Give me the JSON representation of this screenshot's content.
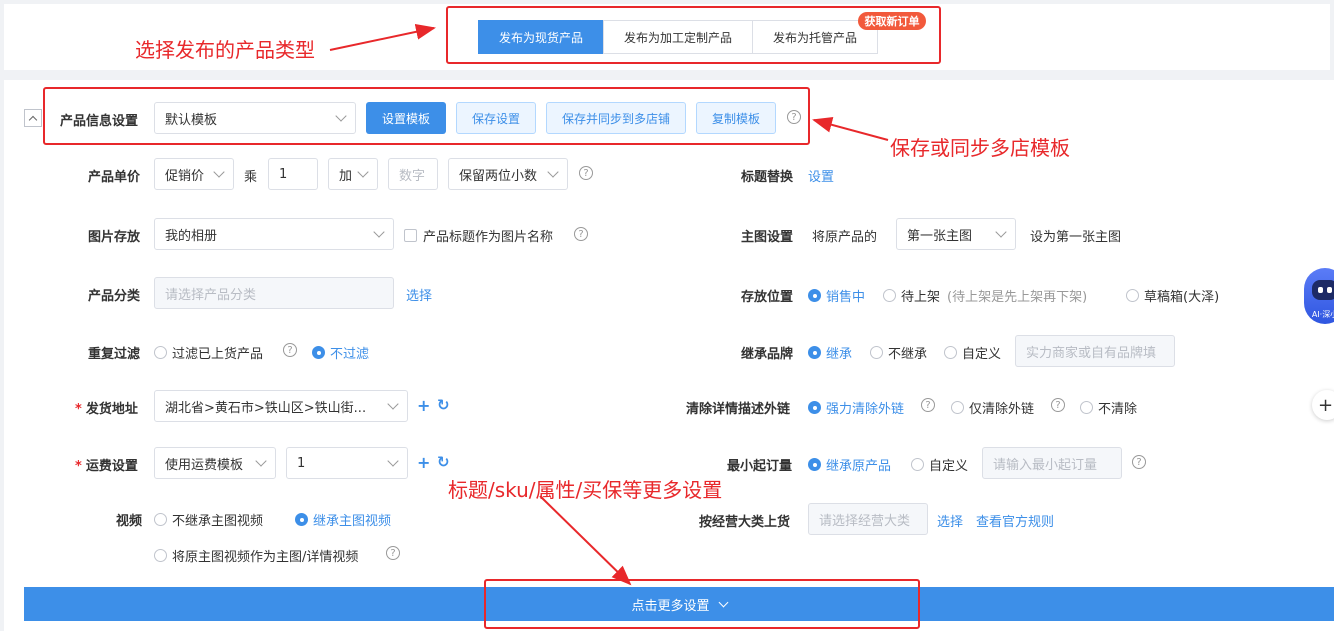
{
  "publish_tabs": [
    {
      "label": "发布为现货产品",
      "active": true
    },
    {
      "label": "发布为加工定制产品",
      "active": false
    },
    {
      "label": "发布为托管产品",
      "active": false
    }
  ],
  "badge_new_order": "获取新订单",
  "annotations": {
    "choose_type": "选择发布的产品类型",
    "save_sync": "保存或同步多店模板",
    "more_settings": "标题/sku/属性/买保等更多设置"
  },
  "template_row": {
    "label": "产品信息设置",
    "select_value": "默认模板",
    "btn_set": "设置模板",
    "btn_save": "保存设置",
    "btn_save_sync": "保存并同步到多店铺",
    "btn_copy": "复制模板"
  },
  "price": {
    "label": "产品单价",
    "price_type": "促销价",
    "mul_text": "乘",
    "mul_value": "1",
    "op": "加",
    "num_placeholder": "数字",
    "decimal": "保留两位小数"
  },
  "title_replace": {
    "label": "标题替换",
    "link": "设置"
  },
  "image_store": {
    "label": "图片存放",
    "value": "我的相册",
    "checkbox": "产品标题作为图片名称"
  },
  "main_image": {
    "label": "主图设置",
    "prefix": "将原产品的",
    "value": "第一张主图",
    "suffix": "设为第一张主图"
  },
  "category": {
    "label": "产品分类",
    "placeholder": "请选择产品分类",
    "link": "选择"
  },
  "location": {
    "label": "存放位置",
    "options": [
      "销售中",
      "待上架",
      "(待上架是先上架再下架)",
      "草稿箱(大泽)"
    ]
  },
  "dup_filter": {
    "label": "重复过滤",
    "options": [
      "过滤已上货产品",
      "不过滤"
    ]
  },
  "brand": {
    "label": "继承品牌",
    "options": [
      "继承",
      "不继承",
      "自定义"
    ],
    "placeholder": "实力商家或自有品牌填"
  },
  "address": {
    "required": "*",
    "label": "发货地址",
    "value": "湖北省>黄石市>铁山区>铁山街..."
  },
  "clear_links": {
    "label": "清除详情描述外链",
    "options": [
      "强力清除外链",
      "仅清除外链",
      "不清除"
    ]
  },
  "shipping": {
    "required": "*",
    "label": "运费设置",
    "value": "使用运费模板",
    "template_value": "1"
  },
  "min_order": {
    "label": "最小起订量",
    "options": [
      "继承原产品",
      "自定义"
    ],
    "placeholder": "请输入最小起订量"
  },
  "video": {
    "label": "视频",
    "options": [
      "不继承主图视频",
      "继承主图视频",
      "将原主图视频作为主图/详情视频"
    ]
  },
  "category_upload": {
    "label": "按经营大类上货",
    "placeholder": "请选择经营大类",
    "link_select": "选择",
    "link_rules": "查看官方规则"
  },
  "more_bar": "点击更多设置",
  "float_ai_label": "AI·深小",
  "help_glyph": "?",
  "plus_glyph": "+",
  "refresh_glyph": "↻",
  "icons": [
    "question-circle-icon",
    "chevron-down-icon",
    "plus-icon",
    "refresh-icon",
    "ai-robot-icon",
    "collapse-up-icon"
  ],
  "colors": {
    "primary": "#3d8fe8",
    "annotation_red": "#e8282b",
    "badge": "#f2593b"
  }
}
